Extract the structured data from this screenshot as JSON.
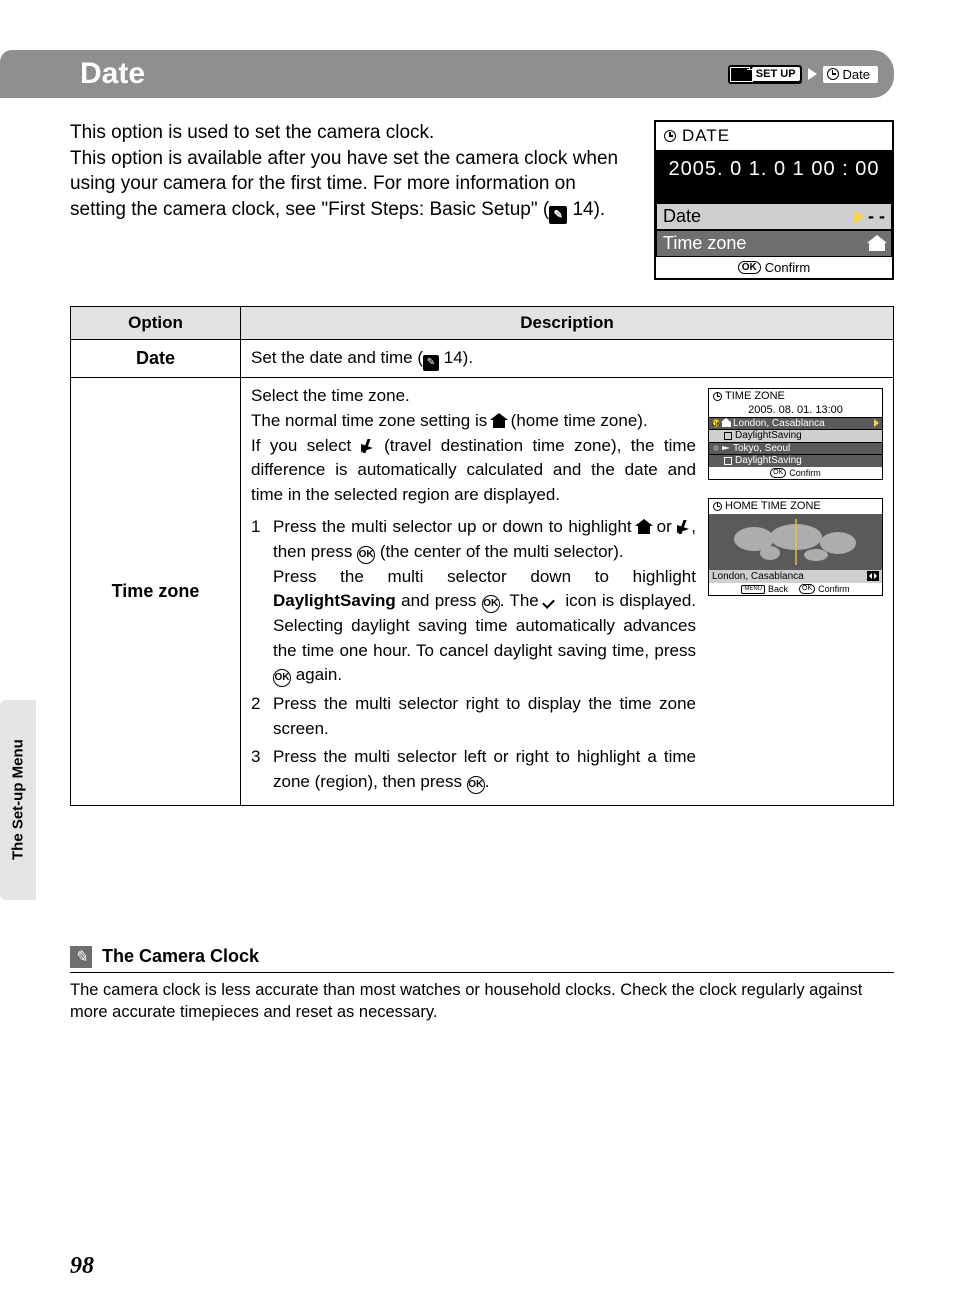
{
  "header": {
    "title": "Date",
    "setup_badge": "SET UP",
    "crumb": "Date"
  },
  "intro": {
    "line1": "This option is used to set the camera clock.",
    "rest": "This option is available after you have set the camera clock when using your camera for the first time. For more information on setting the camera clock, see \"First Steps: Basic Setup\" (",
    "ref": "14",
    "tail": ")."
  },
  "lcd": {
    "title": "DATE",
    "datetime": "2005. 0 1. 0 1  00 : 00",
    "row_date": "Date",
    "row_tz": "Time zone",
    "dash": "- -",
    "confirm": "Confirm"
  },
  "table": {
    "h_option": "Option",
    "h_desc": "Description",
    "rows": [
      {
        "option": "Date",
        "desc_pre": "Set the date and time (",
        "desc_ref": "14",
        "desc_post": ")."
      },
      {
        "option": "Time zone",
        "para1a": "Select the time zone.",
        "para1b_pre": "The normal time zone setting is ",
        "para1b_post": " (home time zone).",
        "para1c_pre": "If you select ",
        "para1c_post": " (travel destination time zone), the time difference is automatically calculated and the date and time in the selected region are displayed.",
        "steps": [
          {
            "n": "1",
            "a": "Press the multi selector up or down to highlight ",
            "b": " or ",
            "c": ", then press ",
            "d": " (the center of the multi selector).",
            "e": "Press the multi selector down to highlight ",
            "bold": "DaylightSaving",
            "f": " and press ",
            "g": ". The ",
            "h": " icon is displayed. Selecting daylight saving time automatically advances the time one hour. To cancel daylight saving time, press ",
            "i": " again."
          },
          {
            "n": "2",
            "t": "Press the multi selector right to display the time zone screen."
          },
          {
            "n": "3",
            "a": "Press the multi selector left or right to highlight a time zone (region), then press ",
            "b": "."
          }
        ],
        "screen_tz": {
          "title": "TIME ZONE",
          "date": "2005. 08. 01.  13:00",
          "home": "London, Casablanca",
          "ds": "DaylightSaving",
          "dest": "Tokyo, Seoul",
          "ds2": "DaylightSaving",
          "confirm": "Confirm"
        },
        "screen_home": {
          "title": "HOME TIME ZONE",
          "loc": "London, Casablanca",
          "back": "Back",
          "confirm": "Confirm"
        }
      }
    ]
  },
  "side_tab": "The Set-up Menu",
  "note": {
    "title": "The Camera Clock",
    "body": "The camera clock is less accurate than most watches or household clocks. Check the clock regularly against more accurate timepieces and reset as necessary."
  },
  "page_number": "98"
}
